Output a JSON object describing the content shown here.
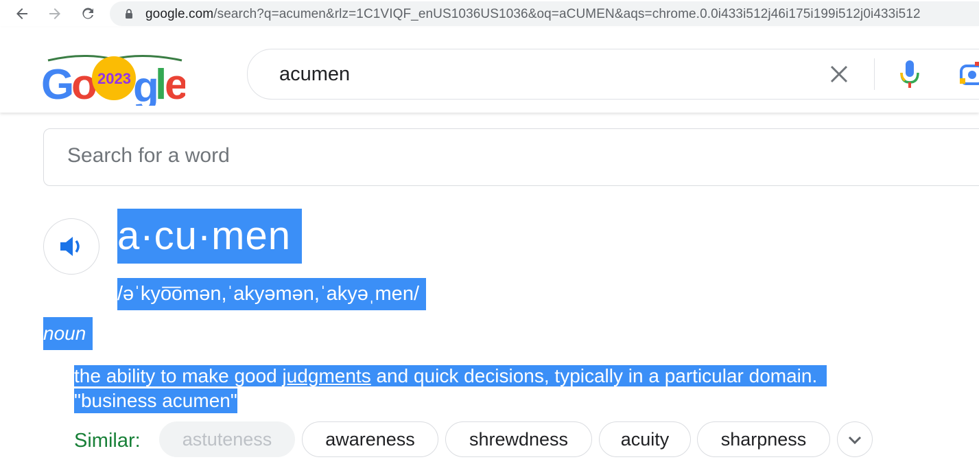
{
  "browser": {
    "url_host": "google.com",
    "url_rest": "/search?q=acumen&rlz=1C1VIQF_enUS1036US1036&oq=aCUMEN&aqs=chrome.0.0i433i512j46i175i199i512j0i433i512"
  },
  "search": {
    "query": "acumen"
  },
  "dictionary": {
    "search_placeholder": "Search for a word",
    "headword": "a·cu·men",
    "phonetic": "/əˈkyo͞omən,ˈakyəmən,ˈakyəˌmen/",
    "part_of_speech": "noun",
    "definition_before": "the ability to make good ",
    "definition_link": "judgments",
    "definition_after": " and quick decisions, typically in a particular domain.",
    "example": "\"business acumen\"",
    "similar_label": "Similar:",
    "similar": [
      "astuteness",
      "awareness",
      "shrewdness",
      "acuity",
      "sharpness"
    ]
  }
}
